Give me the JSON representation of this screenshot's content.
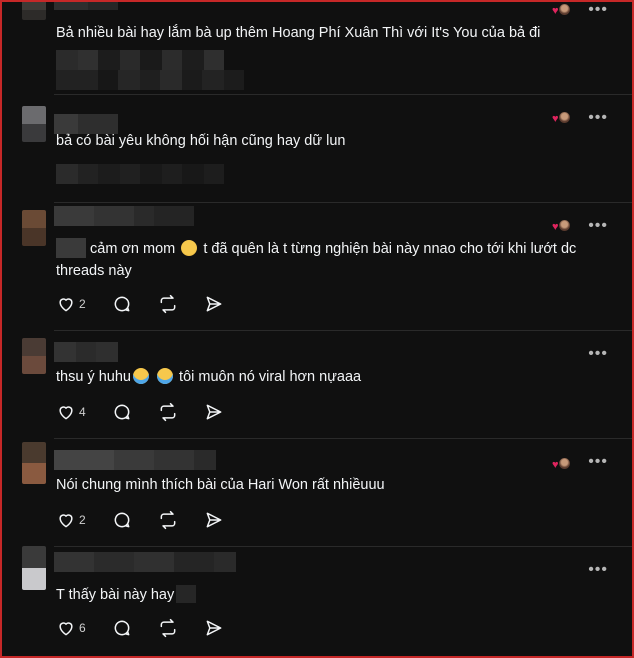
{
  "threads": [
    {
      "text": "Bả nhiều bài hay lắm bà up thêm Hoang Phí Xuân Thì với It's You của bả đi",
      "has_like_badge": true
    },
    {
      "text": "bả có bài yêu không hối hận cũng hay dữ lun",
      "has_like_badge": true
    },
    {
      "text_before_emoji": "cảm ơn mom",
      "emoji": "sad-face-emoji",
      "text_after_emoji": "t đã quên là t từng nghiện bài này nnao cho tới khi lướt dc",
      "text_line2": "threads này",
      "likes": "2",
      "has_like_badge": true
    },
    {
      "text_before_emoji": "thsu ý huhu",
      "emoji": "crying-face-emoji",
      "text_after_emoji": "tôi muôn nó viral hơn nựaaa",
      "likes": "4",
      "has_like_badge": false
    },
    {
      "text": "Nói chung mình thích bài của Hari Won rất nhiềuuu",
      "likes": "2",
      "has_like_badge": true
    },
    {
      "text": "T thấy bài này hay",
      "likes": "6",
      "has_like_badge": false
    }
  ],
  "more_label": "•••",
  "icons": {
    "like": "heart-outline-icon",
    "reply": "comment-icon",
    "repost": "repost-icon",
    "share": "send-icon",
    "liked_heart": "heart-filled-icon"
  },
  "colors": {
    "background": "#101010",
    "text": "#f3f5f7",
    "heart": "#e0245e"
  }
}
